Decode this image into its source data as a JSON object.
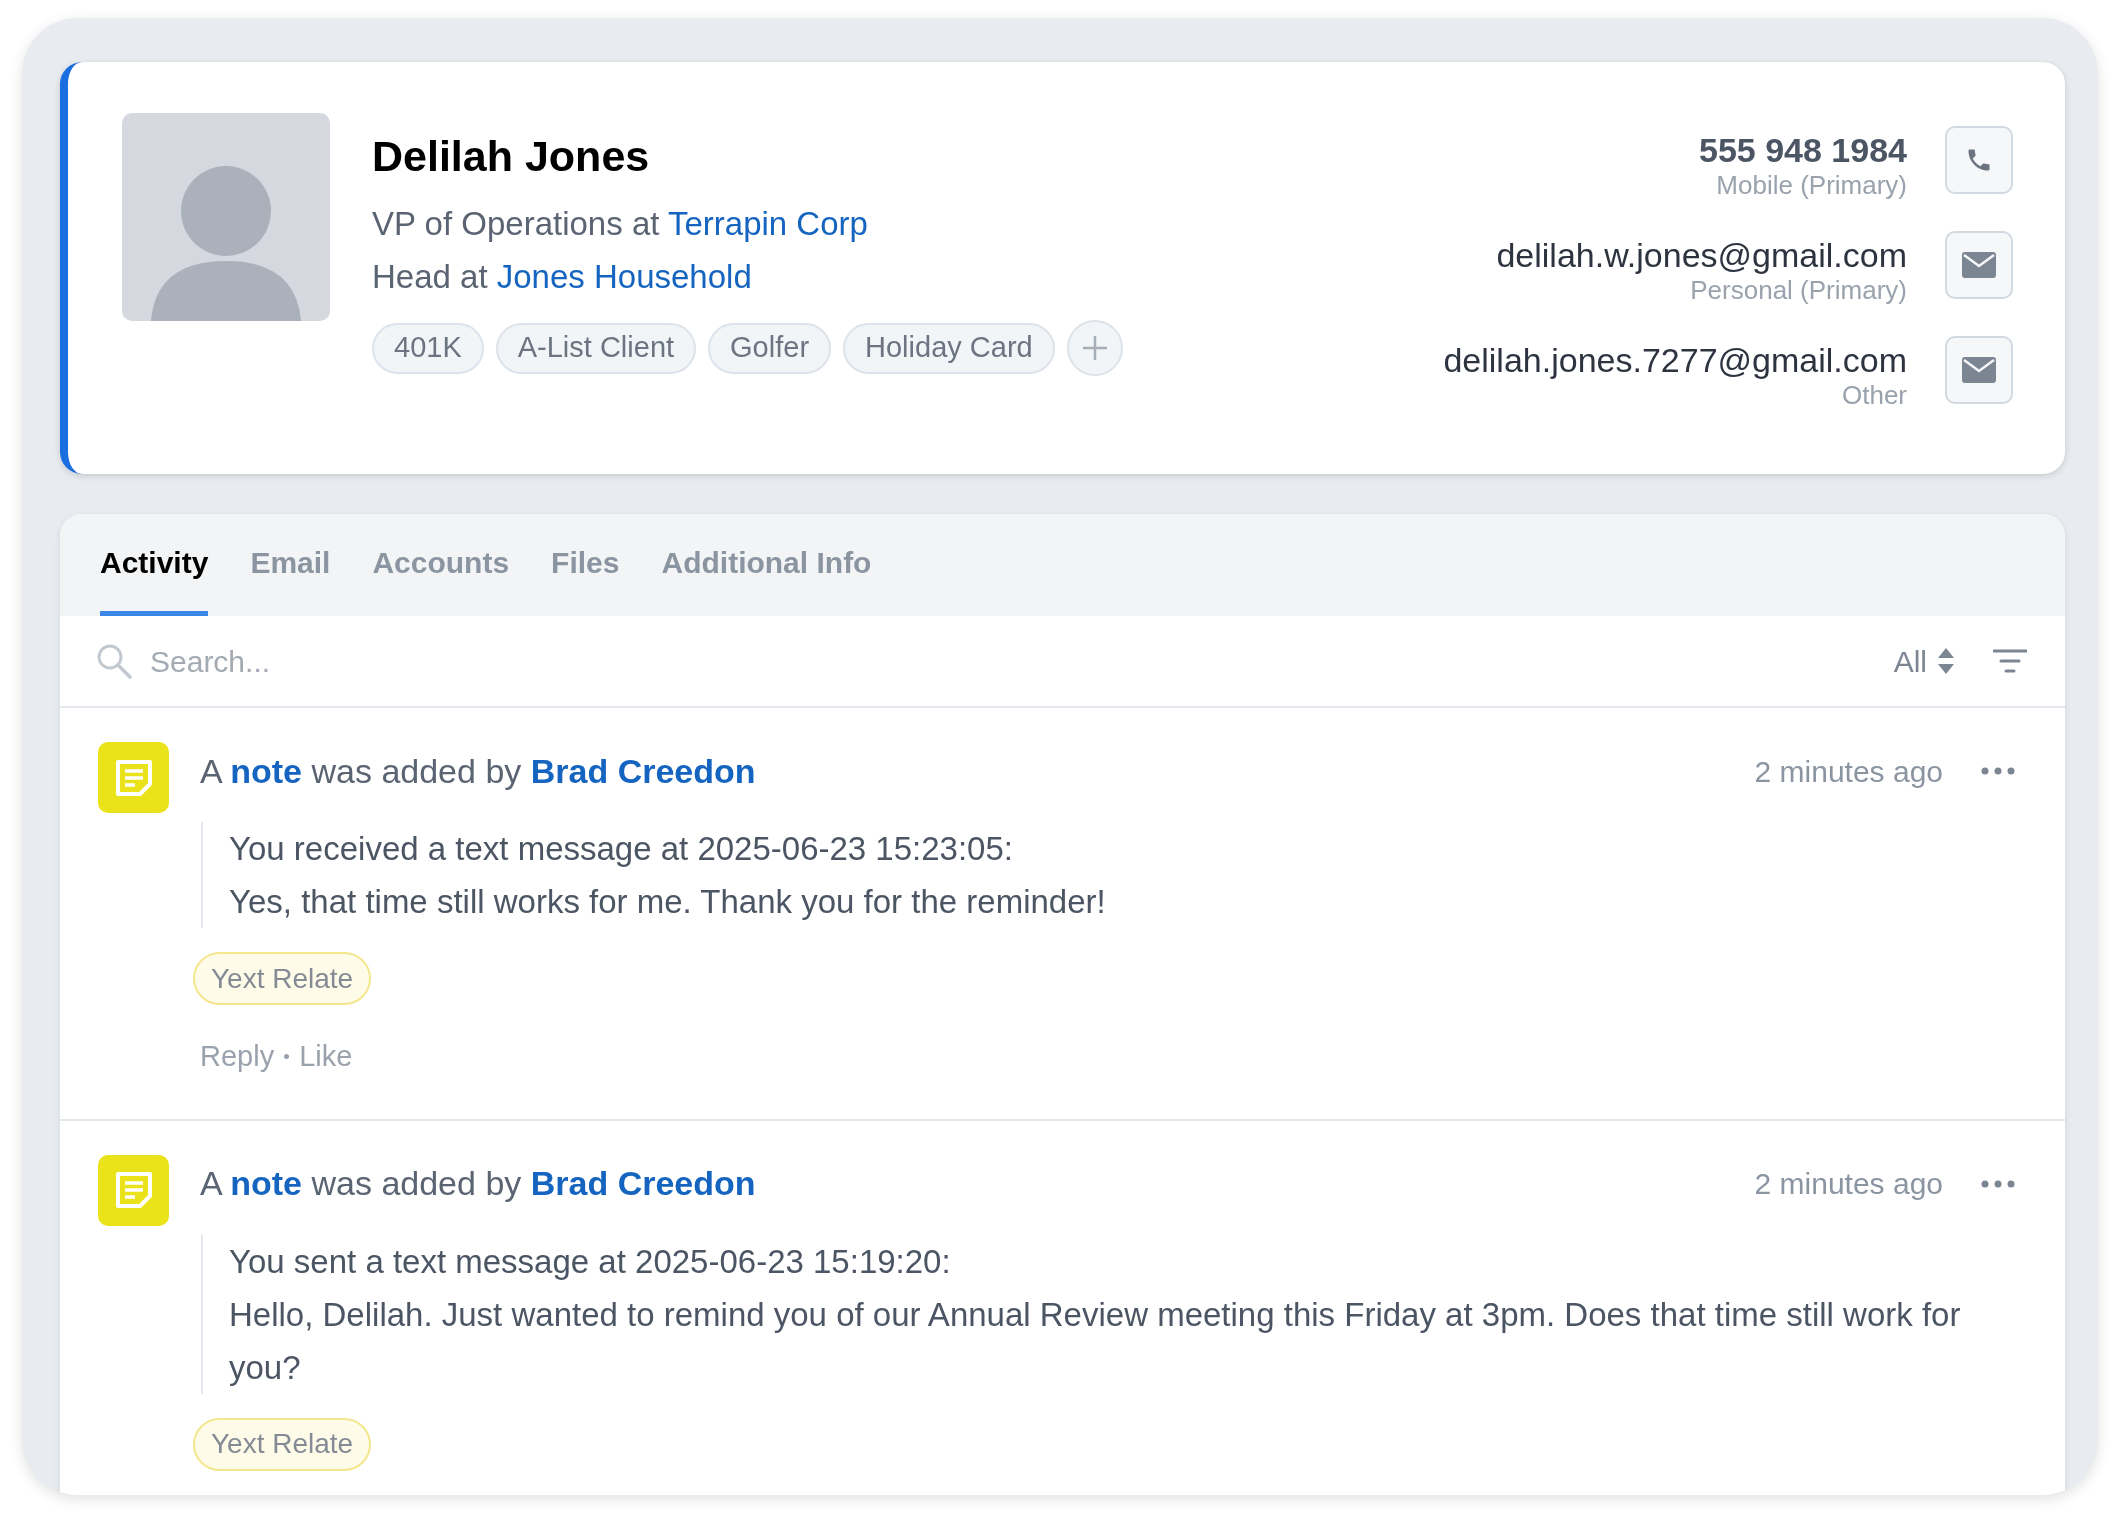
{
  "contact": {
    "name": "Delilah Jones",
    "roles": [
      {
        "title": "VP of Operations at",
        "org": "Terrapin Corp"
      },
      {
        "title": "Head at",
        "org": "Jones Household"
      }
    ],
    "tags": [
      "401K",
      "A-List Client",
      "Golfer",
      "Holiday Card"
    ],
    "methods": [
      {
        "kind": "phone",
        "value": "555 948 1984",
        "label": "Mobile (Primary)"
      },
      {
        "kind": "email",
        "value": "delilah.w.jones@gmail.com",
        "label": "Personal (Primary)"
      },
      {
        "kind": "email",
        "value": "delilah.jones.7277@gmail.com",
        "label": "Other"
      }
    ]
  },
  "tabs": [
    {
      "label": "Activity",
      "selected": true
    },
    {
      "label": "Email",
      "selected": false
    },
    {
      "label": "Accounts",
      "selected": false
    },
    {
      "label": "Files",
      "selected": false
    },
    {
      "label": "Additional Info",
      "selected": false
    }
  ],
  "search": {
    "placeholder": "Search..."
  },
  "filter": {
    "value": "All"
  },
  "activity": [
    {
      "prefix": "A",
      "object": "note",
      "verb": "was added by",
      "author": "Brad Creedon",
      "time": "2 minutes ago",
      "body": [
        "You received a text message at 2025-06-23 15:23:05:",
        "Yes, that time still works for me. Thank you for the reminder!"
      ],
      "tag": "Yext Relate",
      "actions": [
        "Reply",
        "Like"
      ]
    },
    {
      "prefix": "A",
      "object": "note",
      "verb": "was added by",
      "author": "Brad Creedon",
      "time": "2 minutes ago",
      "body": [
        "You sent a text message at 2025-06-23 15:19:20:",
        "Hello, Delilah. Just wanted to remind you of our Annual Review meeting this Friday at 3pm. Does that time still work for you?"
      ],
      "tag": "Yext Relate"
    }
  ]
}
